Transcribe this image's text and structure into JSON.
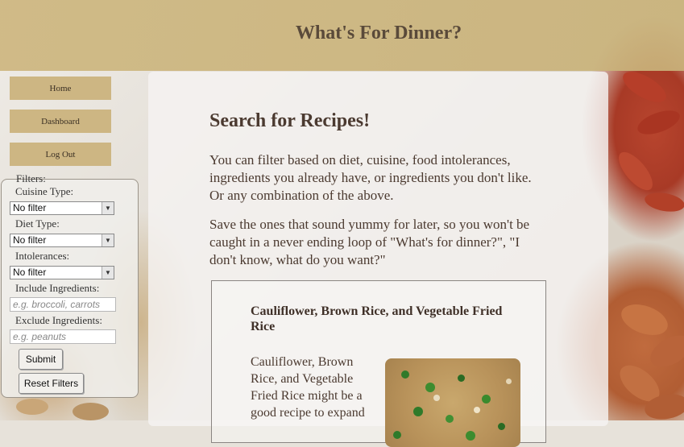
{
  "header": {
    "title": "What's For Dinner?"
  },
  "nav": {
    "home": "Home",
    "dashboard": "Dashboard",
    "logout": "Log Out"
  },
  "filters": {
    "legend": "Filters:",
    "cuisine_label": "Cuisine Type:",
    "cuisine_value": "No filter",
    "diet_label": "Diet Type:",
    "diet_value": "No filter",
    "intolerances_label": "Intolerances:",
    "intolerances_value": "No filter",
    "include_label": "Include Ingredients:",
    "include_placeholder": "e.g. broccoli, carrots",
    "exclude_label": "Exclude Ingredients:",
    "exclude_placeholder": "e.g. peanuts",
    "submit": "Submit",
    "reset": "Reset Filters"
  },
  "main": {
    "heading": "Search for Recipes!",
    "paragraph1": "You can filter based on diet, cuisine, food intolerances, ingredients you already have, or ingredients you don't like. Or any combination of the above.",
    "paragraph2": "Save the ones that sound yummy for later, so you won't be caught in a never ending loop of \"What's for dinner?\", \"I don't know, what do you want?\""
  },
  "recipe": {
    "title": "Cauliflower, Brown Rice, and Vegetable Fried Rice",
    "description": "Cauliflower, Brown Rice, and Vegetable Fried Rice might be a good recipe to expand"
  }
}
